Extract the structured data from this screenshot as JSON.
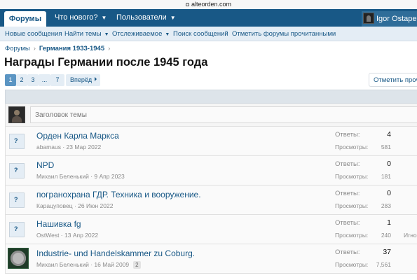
{
  "browser": {
    "url": "alteorden.com"
  },
  "nav": {
    "tabs": [
      {
        "label": "Форумы"
      },
      {
        "label": "Что нового?"
      },
      {
        "label": "Пользователи"
      }
    ],
    "user_name": "Igor Ostapenko"
  },
  "subnav": {
    "items": [
      {
        "label": "Новые сообщения"
      },
      {
        "label": "Найти темы"
      },
      {
        "label": "Отслеживаемое"
      },
      {
        "label": "Поиск сообщений"
      },
      {
        "label": "Отметить форумы прочитанными"
      }
    ]
  },
  "breadcrumb": {
    "items": [
      "Форумы",
      "Германия 1933-1945"
    ]
  },
  "page": {
    "title": "Награды Германии после 1945 года"
  },
  "pagination": {
    "pages": [
      "1",
      "2",
      "3",
      "...",
      "7"
    ],
    "current": "1",
    "next_label": "Вперёд"
  },
  "mark_read_label": "Отметить прочитанным",
  "new_thread": {
    "placeholder": "Заголовок темы"
  },
  "thread_labels": {
    "answers": "Ответы:",
    "views": "Просмотры:"
  },
  "threads": [
    {
      "title": "Орден Карла Маркса",
      "author": "abamaus",
      "date": "23 Мар 2022",
      "answers": "4",
      "views": "581",
      "extra": ""
    },
    {
      "title": "NPD",
      "author": "Михаил Беленький",
      "date": "9 Апр 2023",
      "answers": "0",
      "views": "181",
      "extra": ""
    },
    {
      "title": "погранохрана ГДР. Техника и вооружение.",
      "author": "Карацуповец",
      "date": "26 Июн 2022",
      "answers": "0",
      "views": "283",
      "extra": ""
    },
    {
      "title": "Нашивка fg",
      "author": "OstWest",
      "date": "13 Апр 2022",
      "answers": "1",
      "views": "240",
      "extra": "Игнор"
    },
    {
      "title": "Industrie- und Handelskammer zu Coburg.",
      "author": "Михаил Беленький",
      "date": "16 Май 2009",
      "pages_badge": "2",
      "answers": "37",
      "views": "7,561",
      "extra": ""
    }
  ],
  "colors": {
    "nav_bg": "#185886",
    "link": "#185886",
    "subnav_bg": "#e4edf5",
    "current_page": "#5b95c3"
  }
}
